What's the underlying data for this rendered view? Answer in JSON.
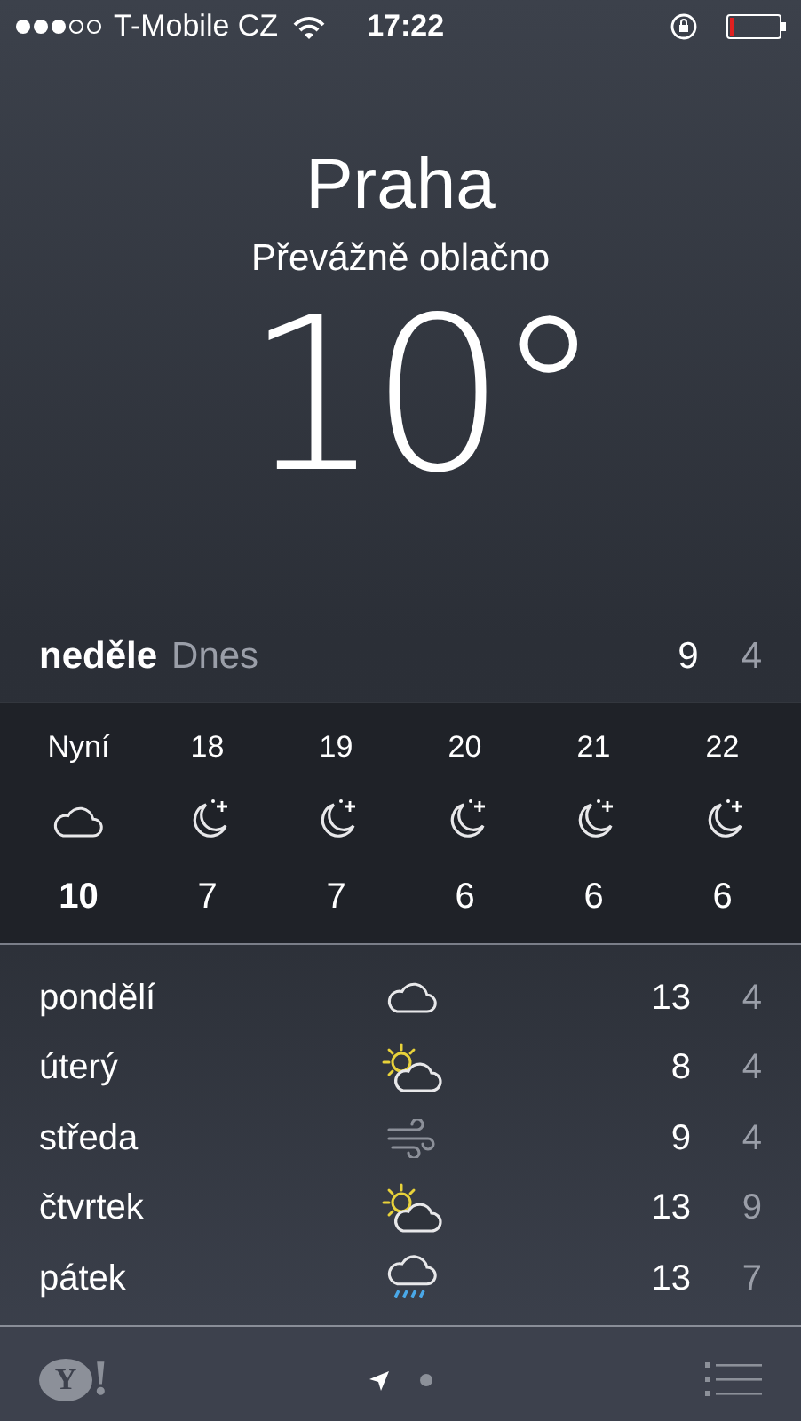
{
  "status_bar": {
    "carrier": "T-Mobile CZ",
    "time": "17:22"
  },
  "header": {
    "city": "Praha",
    "condition": "Převážně oblačno",
    "temperature": "10°"
  },
  "today": {
    "day": "neděle",
    "label": "Dnes",
    "high": "9",
    "low": "4"
  },
  "hourly": [
    {
      "time": "Nyní",
      "kind": "cloud",
      "temp": "10",
      "current": true
    },
    {
      "time": "18",
      "kind": "moon",
      "temp": "7",
      "current": false
    },
    {
      "time": "19",
      "kind": "moon",
      "temp": "7",
      "current": false
    },
    {
      "time": "20",
      "kind": "moon",
      "temp": "6",
      "current": false
    },
    {
      "time": "21",
      "kind": "moon",
      "temp": "6",
      "current": false
    },
    {
      "time": "22",
      "kind": "moon",
      "temp": "6",
      "current": false
    }
  ],
  "daily": [
    {
      "day": "pondělí",
      "kind": "cloud",
      "high": "13",
      "low": "4"
    },
    {
      "day": "úterý",
      "kind": "partly-sunny",
      "high": "8",
      "low": "4"
    },
    {
      "day": "středa",
      "kind": "wind",
      "high": "9",
      "low": "4"
    },
    {
      "day": "čtvrtek",
      "kind": "partly-sunny",
      "high": "13",
      "low": "9"
    },
    {
      "day": "pátek",
      "kind": "rain",
      "high": "13",
      "low": "7"
    }
  ],
  "footer": {
    "logo": [
      "Y",
      "!"
    ],
    "pages": [
      {
        "kind": "location",
        "selected": true
      },
      {
        "kind": "dot",
        "selected": false
      }
    ]
  }
}
